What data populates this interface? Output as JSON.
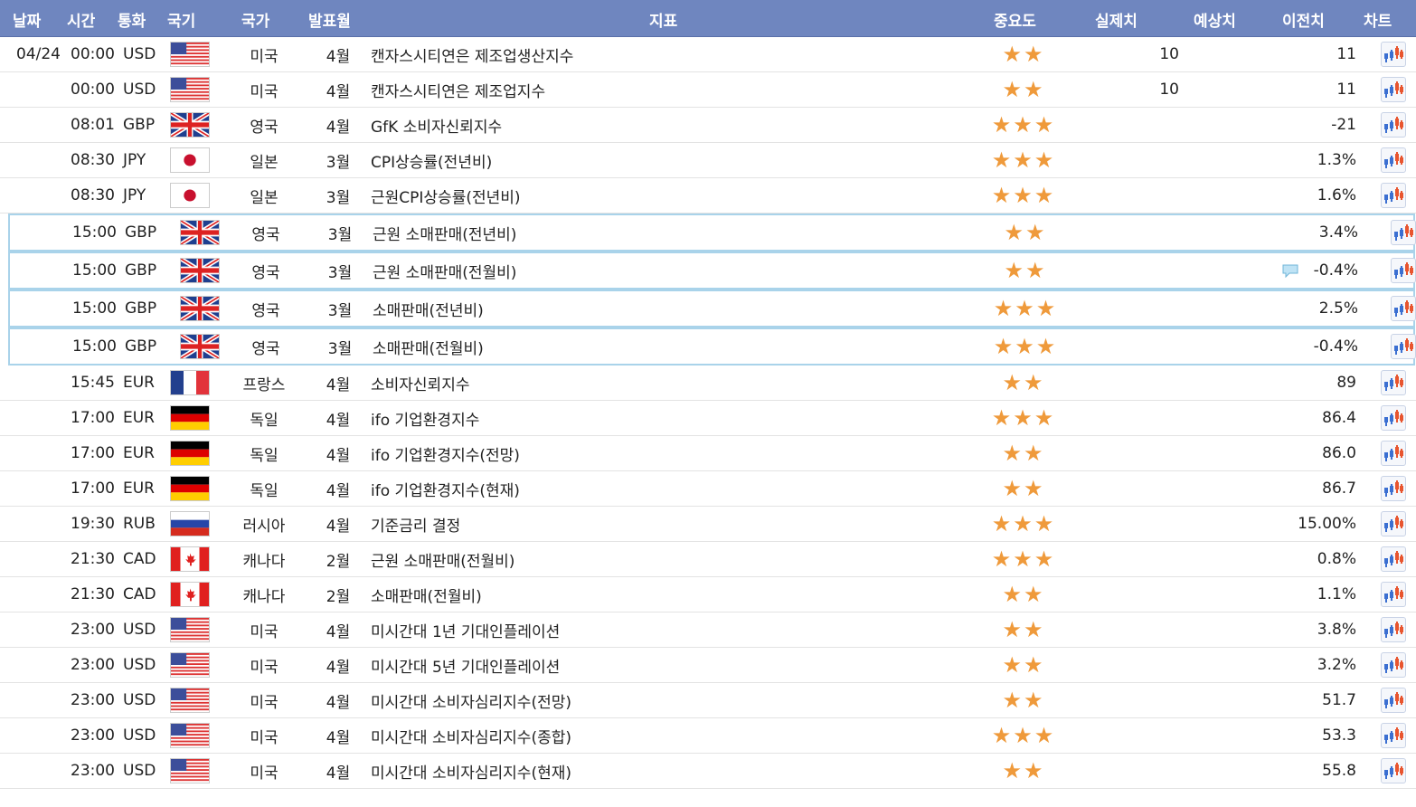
{
  "headers": {
    "date": "날짜",
    "time": "시간",
    "currency": "통화",
    "flag": "국기",
    "country": "국가",
    "month": "발표월",
    "indicator": "지표",
    "importance": "중요도",
    "actual": "실제치",
    "forecast": "예상치",
    "previous": "이전치",
    "chart": "차트"
  },
  "rows": [
    {
      "date": "04/24",
      "time": "00:00",
      "cur": "USD",
      "flag": "us",
      "country": "미국",
      "month": "4월",
      "ind": "캔자스시티연은 제조업생산지수",
      "stars": 2,
      "actual": "10",
      "fc": "",
      "prev": "11"
    },
    {
      "date": "",
      "time": "00:00",
      "cur": "USD",
      "flag": "us",
      "country": "미국",
      "month": "4월",
      "ind": "캔자스시티연은 제조업지수",
      "stars": 2,
      "actual": "10",
      "fc": "",
      "prev": "11"
    },
    {
      "date": "",
      "time": "08:01",
      "cur": "GBP",
      "flag": "gb",
      "country": "영국",
      "month": "4월",
      "ind": "GfK 소비자신뢰지수",
      "stars": 3,
      "actual": "",
      "fc": "",
      "prev": "-21"
    },
    {
      "date": "",
      "time": "08:30",
      "cur": "JPY",
      "flag": "jp",
      "country": "일본",
      "month": "3월",
      "ind": "CPI상승률(전년비)",
      "stars": 3,
      "actual": "",
      "fc": "",
      "prev": "1.3%"
    },
    {
      "date": "",
      "time": "08:30",
      "cur": "JPY",
      "flag": "jp",
      "country": "일본",
      "month": "3월",
      "ind": "근원CPI상승률(전년비)",
      "stars": 3,
      "actual": "",
      "fc": "",
      "prev": "1.6%"
    },
    {
      "date": "",
      "time": "15:00",
      "cur": "GBP",
      "flag": "gb",
      "country": "영국",
      "month": "3월",
      "ind": "근원 소매판매(전년비)",
      "stars": 2,
      "actual": "",
      "fc": "",
      "prev": "3.4%",
      "hl": true
    },
    {
      "date": "",
      "time": "15:00",
      "cur": "GBP",
      "flag": "gb",
      "country": "영국",
      "month": "3월",
      "ind": "근원 소매판매(전월비)",
      "stars": 2,
      "actual": "",
      "fc": "",
      "prev": "-0.4%",
      "hl": true,
      "comment": true
    },
    {
      "date": "",
      "time": "15:00",
      "cur": "GBP",
      "flag": "gb",
      "country": "영국",
      "month": "3월",
      "ind": "소매판매(전년비)",
      "stars": 3,
      "actual": "",
      "fc": "",
      "prev": "2.5%",
      "hl": true
    },
    {
      "date": "",
      "time": "15:00",
      "cur": "GBP",
      "flag": "gb",
      "country": "영국",
      "month": "3월",
      "ind": "소매판매(전월비)",
      "stars": 3,
      "actual": "",
      "fc": "",
      "prev": "-0.4%",
      "hl": true
    },
    {
      "date": "",
      "time": "15:45",
      "cur": "EUR",
      "flag": "fr",
      "country": "프랑스",
      "month": "4월",
      "ind": "소비자신뢰지수",
      "stars": 2,
      "actual": "",
      "fc": "",
      "prev": "89"
    },
    {
      "date": "",
      "time": "17:00",
      "cur": "EUR",
      "flag": "de",
      "country": "독일",
      "month": "4월",
      "ind": "ifo 기업환경지수",
      "stars": 3,
      "actual": "",
      "fc": "",
      "prev": "86.4"
    },
    {
      "date": "",
      "time": "17:00",
      "cur": "EUR",
      "flag": "de",
      "country": "독일",
      "month": "4월",
      "ind": "ifo 기업환경지수(전망)",
      "stars": 2,
      "actual": "",
      "fc": "",
      "prev": "86.0"
    },
    {
      "date": "",
      "time": "17:00",
      "cur": "EUR",
      "flag": "de",
      "country": "독일",
      "month": "4월",
      "ind": "ifo 기업환경지수(현재)",
      "stars": 2,
      "actual": "",
      "fc": "",
      "prev": "86.7"
    },
    {
      "date": "",
      "time": "19:30",
      "cur": "RUB",
      "flag": "ru",
      "country": "러시아",
      "month": "4월",
      "ind": "기준금리 결정",
      "stars": 3,
      "actual": "",
      "fc": "",
      "prev": "15.00%"
    },
    {
      "date": "",
      "time": "21:30",
      "cur": "CAD",
      "flag": "ca",
      "country": "캐나다",
      "month": "2월",
      "ind": "근원 소매판매(전월비)",
      "stars": 3,
      "actual": "",
      "fc": "",
      "prev": "0.8%"
    },
    {
      "date": "",
      "time": "21:30",
      "cur": "CAD",
      "flag": "ca",
      "country": "캐나다",
      "month": "2월",
      "ind": "소매판매(전월비)",
      "stars": 2,
      "actual": "",
      "fc": "",
      "prev": "1.1%"
    },
    {
      "date": "",
      "time": "23:00",
      "cur": "USD",
      "flag": "us",
      "country": "미국",
      "month": "4월",
      "ind": "미시간대 1년 기대인플레이션",
      "stars": 2,
      "actual": "",
      "fc": "",
      "prev": "3.8%"
    },
    {
      "date": "",
      "time": "23:00",
      "cur": "USD",
      "flag": "us",
      "country": "미국",
      "month": "4월",
      "ind": "미시간대 5년 기대인플레이션",
      "stars": 2,
      "actual": "",
      "fc": "",
      "prev": "3.2%"
    },
    {
      "date": "",
      "time": "23:00",
      "cur": "USD",
      "flag": "us",
      "country": "미국",
      "month": "4월",
      "ind": "미시간대 소비자심리지수(전망)",
      "stars": 2,
      "actual": "",
      "fc": "",
      "prev": "51.7"
    },
    {
      "date": "",
      "time": "23:00",
      "cur": "USD",
      "flag": "us",
      "country": "미국",
      "month": "4월",
      "ind": "미시간대 소비자심리지수(종합)",
      "stars": 3,
      "actual": "",
      "fc": "",
      "prev": "53.3"
    },
    {
      "date": "",
      "time": "23:00",
      "cur": "USD",
      "flag": "us",
      "country": "미국",
      "month": "4월",
      "ind": "미시간대 소비자심리지수(현재)",
      "stars": 2,
      "actual": "",
      "fc": "",
      "prev": "55.8"
    }
  ],
  "colors": {
    "header": "#6f86bf",
    "star": "#ef9a3b",
    "highlight_border": "#a9d3ea"
  }
}
